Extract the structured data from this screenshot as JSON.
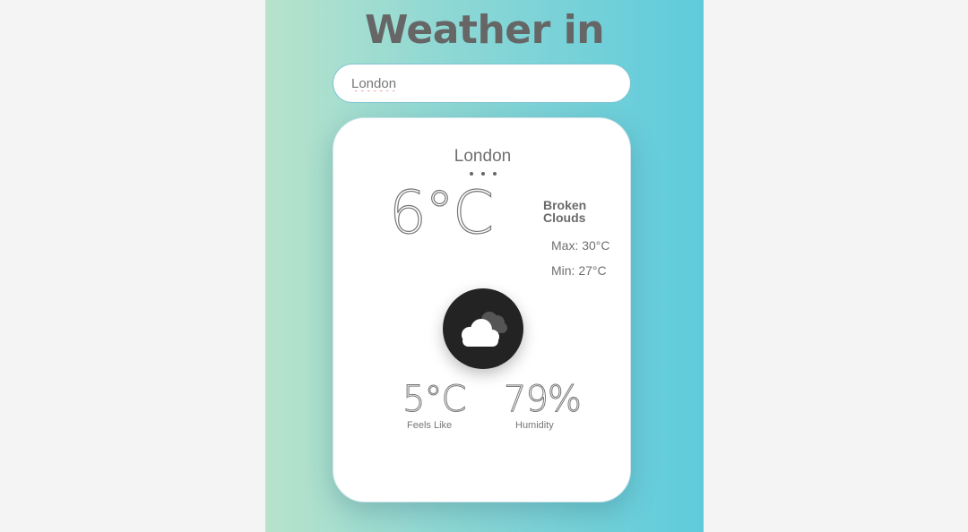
{
  "app": {
    "title": "Weather in"
  },
  "search": {
    "value": "London",
    "placeholder": ""
  },
  "weather": {
    "city": "London",
    "temperature": "6°C",
    "description": "Broken Clouds",
    "max": "Max: 30°C",
    "min": "Min: 27°C",
    "icon": "broken-clouds-icon",
    "feels_like_value": "5°C",
    "feels_like_label": "Feels Like",
    "humidity_value": "79%",
    "humidity_label": "Humidity"
  },
  "colors": {
    "gradient_left": "#b8e3cb",
    "gradient_right": "#5ecbdc",
    "title_text": "#666666",
    "icon_background": "#232323"
  }
}
